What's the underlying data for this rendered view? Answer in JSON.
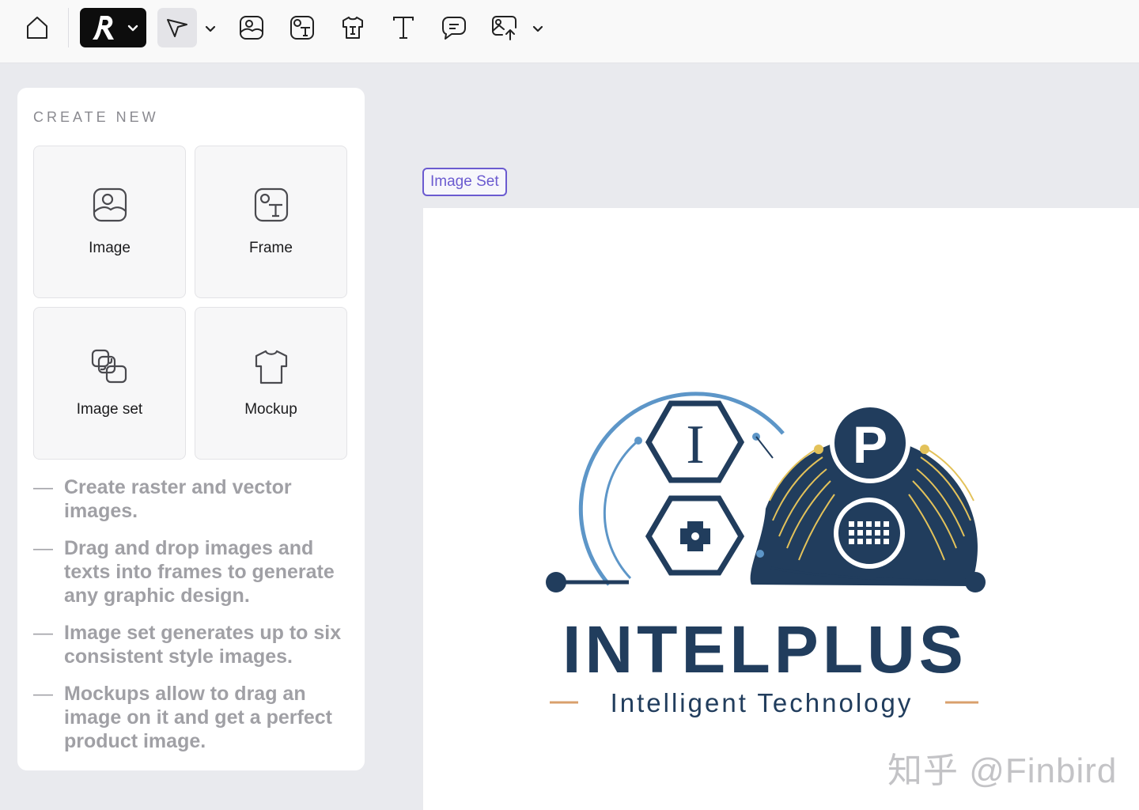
{
  "toolbar": {
    "items": [
      {
        "icon": "home-icon"
      },
      {
        "icon": "brand-logo-icon"
      },
      {
        "icon": "pointer-icon"
      },
      {
        "icon": "image-icon"
      },
      {
        "icon": "frame-icon"
      },
      {
        "icon": "mockup-icon"
      },
      {
        "icon": "text-icon"
      },
      {
        "icon": "comment-icon"
      },
      {
        "icon": "upload-icon"
      }
    ]
  },
  "panel": {
    "title": "CREATE NEW",
    "cards": [
      {
        "label": "Image",
        "icon": "image-icon"
      },
      {
        "label": "Frame",
        "icon": "frame-icon"
      },
      {
        "label": "Image set",
        "icon": "image-set-icon"
      },
      {
        "label": "Mockup",
        "icon": "mockup-icon"
      }
    ],
    "tips": [
      "Create raster and vector images.",
      "Drag and drop images and texts into frames to generate any graphic design.",
      "Image set generates up to six consistent style images.",
      "Mockups allow to drag an image on it and get a perfect product image."
    ]
  },
  "canvas": {
    "tag": "Image Set",
    "logo": {
      "letters": [
        "I",
        "P"
      ],
      "title": "INTELPLUS",
      "tagline": "Intelligent Technology"
    },
    "watermark": "知乎 @Finbird"
  },
  "colors": {
    "accent": "#6b5bd0",
    "logo_navy": "#213d5d",
    "logo_blue": "#5d96c8",
    "logo_gold": "#e3c25a",
    "tagline_line": "#d9a06c"
  }
}
